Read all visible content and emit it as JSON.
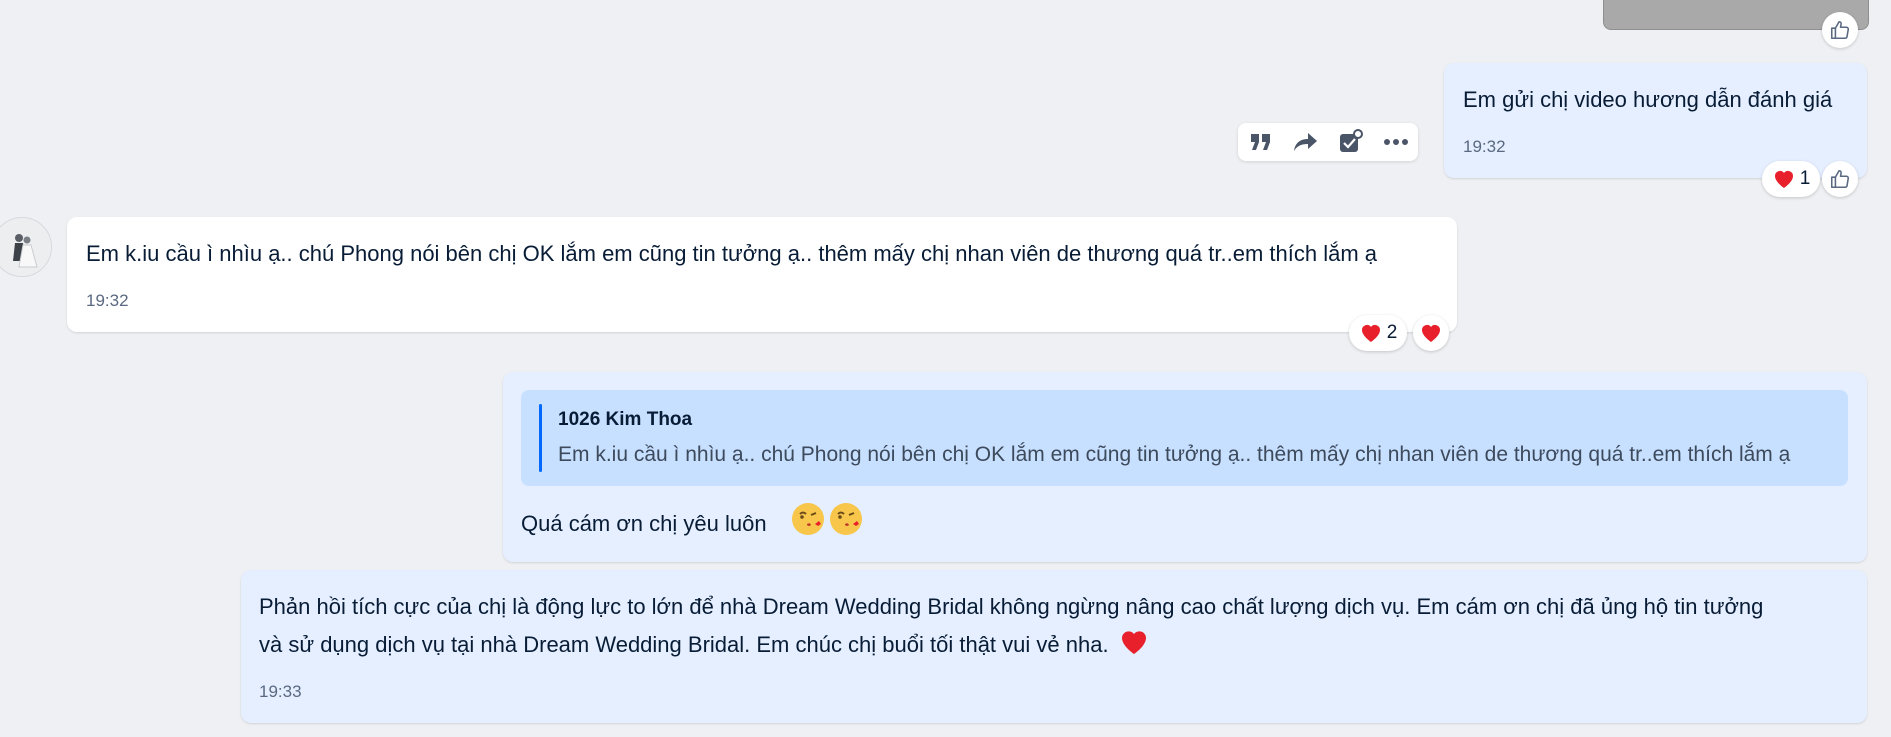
{
  "messages": [
    {
      "text": "Em gửi chị video hương dẫn đánh giá",
      "time": "19:32",
      "reaction_count": "1"
    },
    {
      "text": "Em k.iu cầu ì nhìu ạ.. chú Phong nói bên chị OK lắm em cũng tin tưởng ạ.. thêm mấy chị nhan viên de thương quá tr..em thích lắm ạ",
      "time": "19:32",
      "reaction_count": "2"
    },
    {
      "quote_author": "1026 Kim Thoa",
      "quote_text": "Em k.iu cầu ì nhìu ạ.. chú Phong nói bên chị OK lắm em cũng tin tưởng ạ.. thêm mấy chị nhan viên de thương quá tr..em thích lắm ạ",
      "text": "Quá cám ơn chị yêu luôn"
    },
    {
      "line1": "Phản hồi tích cực của chị là động lực to lớn để nhà Dream Wedding Bridal không ngừng nâng cao chất lượng dịch vụ. Em cám ơn chị đã ủng hộ tin tưởng",
      "line2": "và sử dụng dịch vụ tại nhà Dream Wedding Bridal. Em chúc chị buổi tối thật vui vẻ nha.",
      "time": "19:33"
    }
  ],
  "icons": {
    "like": "thumbs-up-icon",
    "heart": "heart-icon",
    "quote": "quote-icon",
    "forward": "forward-icon",
    "task": "task-icon",
    "more": "more-icon",
    "emoji": "kissing-face-icon"
  },
  "colors": {
    "background": "#eef0f3",
    "my_bubble": "#e5efff",
    "their_bubble": "#ffffff",
    "quote_bg": "#c7e0ff",
    "quote_bar": "#0068ff",
    "heart": "#e8202b",
    "time": "#5a6981"
  }
}
